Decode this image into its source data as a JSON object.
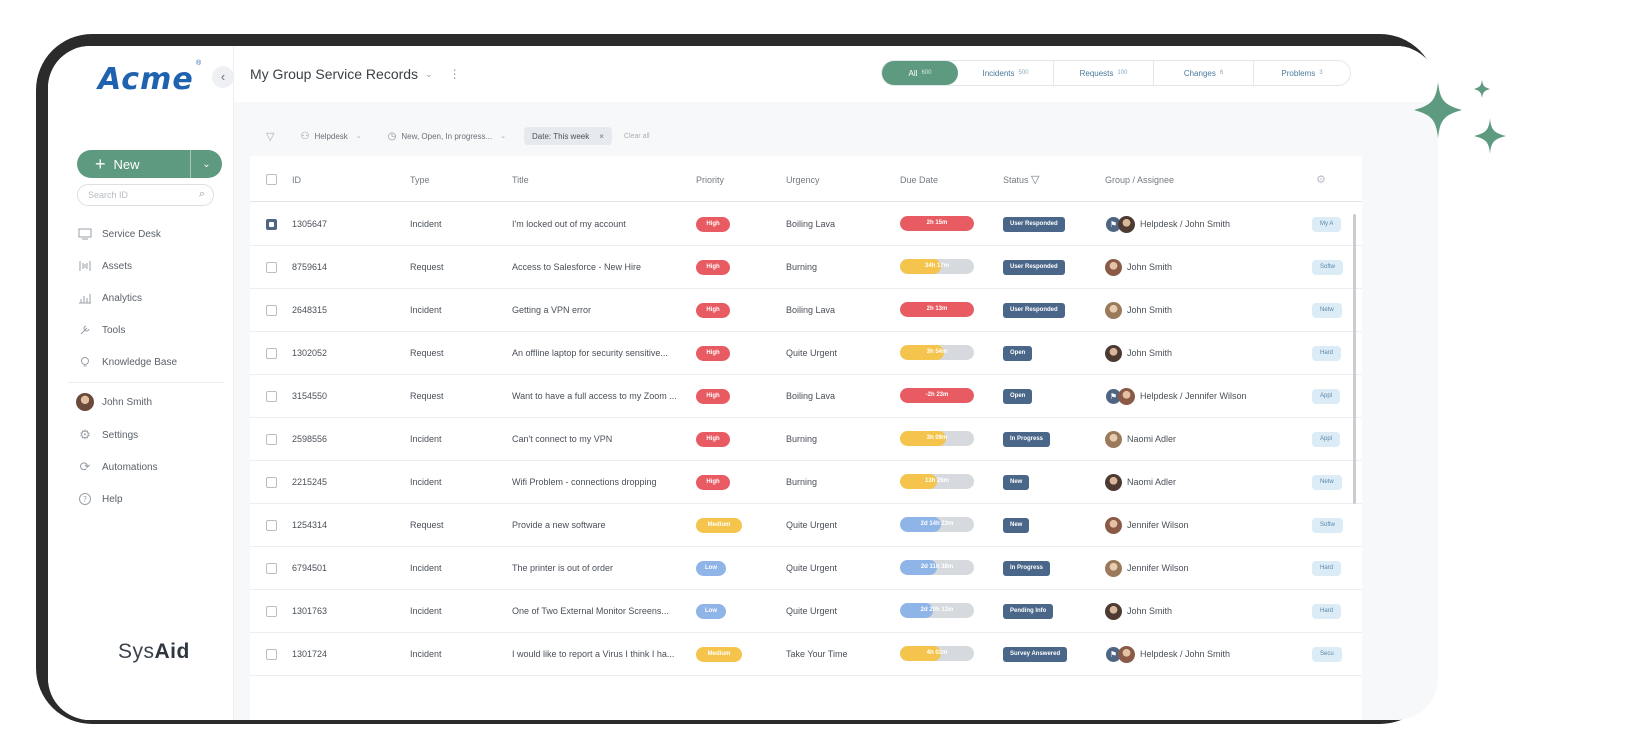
{
  "app": {
    "logo": "Acme",
    "logo_mark": "®",
    "brand": {
      "prefix": "Sys",
      "suffix": "Aid"
    },
    "accent_color": "#5e9a80",
    "status_color": "#4a6688"
  },
  "sidebar": {
    "collapse_icon": "chevron-left-icon",
    "new_button": {
      "label": "New",
      "icon": "plus-icon",
      "caret": "chevron-down-icon"
    },
    "search": {
      "placeholder": "Search ID",
      "icon": "search-icon"
    },
    "nav": [
      {
        "label": "Service Desk",
        "icon": "service-desk-icon"
      },
      {
        "label": "Assets",
        "icon": "assets-icon"
      },
      {
        "label": "Analytics",
        "icon": "analytics-icon"
      },
      {
        "label": "Tools",
        "icon": "tools-icon"
      },
      {
        "label": "Knowledge Base",
        "icon": "knowledge-base-icon"
      }
    ],
    "user": {
      "name": "John Smith"
    },
    "settings": [
      {
        "label": "Settings",
        "icon": "gear-icon"
      },
      {
        "label": "Automations",
        "icon": "automations-icon"
      },
      {
        "label": "Help",
        "icon": "help-icon"
      }
    ]
  },
  "header": {
    "title": "My Group Service Records",
    "tabs": [
      {
        "label": "All",
        "count": "600",
        "active": true
      },
      {
        "label": "Incidents",
        "count": "500",
        "active": false
      },
      {
        "label": "Requests",
        "count": "100",
        "active": false
      },
      {
        "label": "Changes",
        "count": "6",
        "active": false
      },
      {
        "label": "Problems",
        "count": "3",
        "active": false
      }
    ]
  },
  "filters": {
    "group": "Helpdesk",
    "status": "New, Open, In progress...",
    "date": "Date: This week",
    "clear": "Clear all"
  },
  "table": {
    "columns": [
      "ID",
      "Type",
      "Title",
      "Priority",
      "Urgency",
      "Due Date",
      "Status",
      "Group / Assignee"
    ],
    "rows": [
      {
        "checked": true,
        "id": "1305647",
        "type": "Incident",
        "title": "I'm locked out of my account",
        "priority": "High",
        "urgency": "Boiling Lava",
        "due": "2h 15m",
        "due_fill": 1.0,
        "due_color": "#e85b62",
        "status": "User Responded",
        "assignee": "Helpdesk / John Smith",
        "group": true,
        "category": "My A"
      },
      {
        "checked": false,
        "id": "8759614",
        "type": "Request",
        "title": "Access to Salesforce - New Hire",
        "priority": "High",
        "urgency": "Burning",
        "due": "34h 17m",
        "due_fill": 0.55,
        "due_color": "#f4c44c",
        "status": "User Responded",
        "assignee": "John Smith",
        "group": false,
        "category": "Softw"
      },
      {
        "checked": false,
        "id": "2648315",
        "type": "Incident",
        "title": "Getting a VPN error",
        "priority": "High",
        "urgency": "Boiling Lava",
        "due": "2h 13m",
        "due_fill": 1.0,
        "due_color": "#e85b62",
        "status": "User Responded",
        "assignee": "John Smith",
        "group": false,
        "category": "Netw"
      },
      {
        "checked": false,
        "id": "1302052",
        "type": "Request",
        "title": "An offline laptop for security sensitive...",
        "priority": "High",
        "urgency": "Quite Urgent",
        "due": "3h 54m",
        "due_fill": 0.6,
        "due_color": "#f4c44c",
        "status": "Open",
        "assignee": "John Smith",
        "group": false,
        "category": "Hard"
      },
      {
        "checked": false,
        "id": "3154550",
        "type": "Request",
        "title": "Want to have a full access to my Zoom ...",
        "priority": "High",
        "urgency": "Boiling Lava",
        "due": "-2h 23m",
        "due_fill": 1.0,
        "due_color": "#e85b62",
        "status": "Open",
        "assignee": "Helpdesk / Jennifer Wilson",
        "group": true,
        "category": "Appl"
      },
      {
        "checked": false,
        "id": "2598556",
        "type": "Incident",
        "title": "Can't connect to my VPN",
        "priority": "High",
        "urgency": "Burning",
        "due": "3h 09m",
        "due_fill": 0.62,
        "due_color": "#f4c44c",
        "status": "In Progress",
        "assignee": "Naomi Adler",
        "group": false,
        "category": "Appl"
      },
      {
        "checked": false,
        "id": "2215245",
        "type": "Incident",
        "title": "Wifi Problem - connections dropping",
        "priority": "High",
        "urgency": "Burning",
        "due": "13h 26m",
        "due_fill": 0.5,
        "due_color": "#f4c44c",
        "status": "New",
        "assignee": "Naomi Adler",
        "group": false,
        "category": "Netw"
      },
      {
        "checked": false,
        "id": "1254314",
        "type": "Request",
        "title": "Provide a new software",
        "priority": "Medium",
        "urgency": "Quite Urgent",
        "due": "2d 14h 23m",
        "due_fill": 0.55,
        "due_color": "#8fb4e8",
        "status": "New",
        "assignee": "Jennifer Wilson",
        "group": false,
        "category": "Softw"
      },
      {
        "checked": false,
        "id": "6794501",
        "type": "Incident",
        "title": "The printer is out of order",
        "priority": "Low",
        "urgency": "Quite Urgent",
        "due": "2d 11h 38m",
        "due_fill": 0.5,
        "due_color": "#8fb4e8",
        "status": "In Progress",
        "assignee": "Jennifer Wilson",
        "group": false,
        "category": "Hard"
      },
      {
        "checked": false,
        "id": "1301763",
        "type": "Incident",
        "title": "One of Two External Monitor Screens...",
        "priority": "Low",
        "urgency": "Quite Urgent",
        "due": "2d 20h 13m",
        "due_fill": 0.45,
        "due_color": "#8fb4e8",
        "status": "Pending Info",
        "assignee": "John Smith",
        "group": false,
        "category": "Hard"
      },
      {
        "checked": false,
        "id": "1301724",
        "type": "Incident",
        "title": "I would like to report a Virus I think I ha...",
        "priority": "Medium",
        "urgency": "Take Your Time",
        "due": "4h 02m",
        "due_fill": 0.55,
        "due_color": "#f4c44c",
        "status": "Survey Answered",
        "assignee": "Helpdesk / John Smith",
        "group": true,
        "category": "Secu"
      }
    ]
  }
}
